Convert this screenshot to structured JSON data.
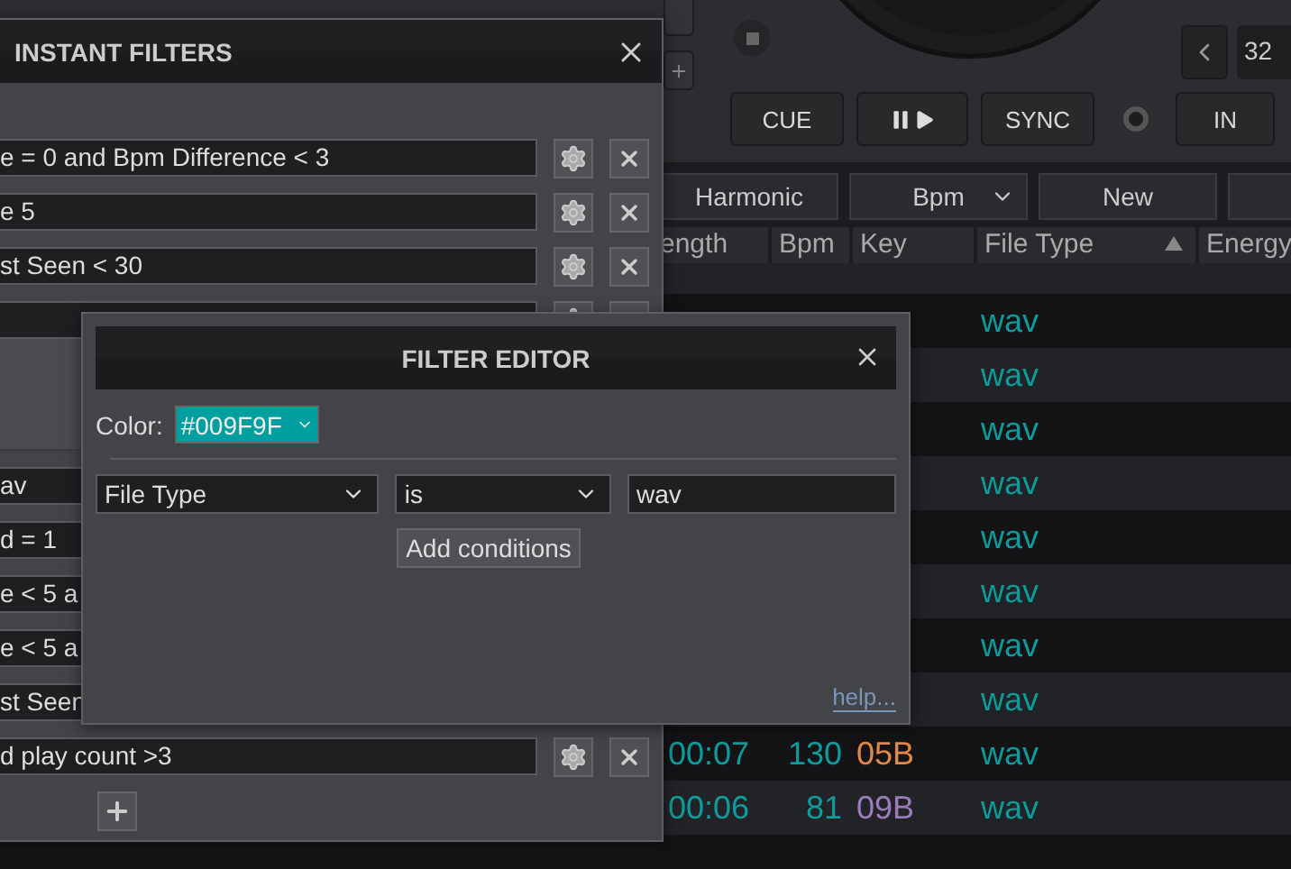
{
  "deck": {
    "buttons": [
      {
        "kind": "text",
        "label": "CUE"
      },
      {
        "kind": "playpause"
      },
      {
        "kind": "text",
        "label": "SYNC"
      }
    ],
    "in_button": "IN",
    "loop_value": "32"
  },
  "toolbar": [
    {
      "label": "Harmonic",
      "dropdown": false
    },
    {
      "label": "Bpm",
      "dropdown": true
    },
    {
      "label": "New",
      "dropdown": false
    }
  ],
  "table": {
    "columns": [
      {
        "label": "ength",
        "sorted": false
      },
      {
        "label": "Bpm",
        "sorted": false
      },
      {
        "label": "Key",
        "sorted": false
      },
      {
        "label": "File Type",
        "sorted": true
      },
      {
        "label": "Energy",
        "sorted": false
      }
    ],
    "rows": [
      {
        "file_type": "wav"
      },
      {
        "file_type": "wav"
      },
      {
        "file_type": "wav"
      },
      {
        "file_type": "wav"
      },
      {
        "file_type": "wav"
      },
      {
        "file_type": "wav"
      },
      {
        "file_type": "wav"
      },
      {
        "file_type": "wav"
      },
      {
        "length": "00:07",
        "bpm": "130",
        "key": "05B",
        "color": "#e0884a",
        "file_type": "wav"
      },
      {
        "length": "00:06",
        "bpm": "81",
        "key": "09B",
        "color": "#9a7cbc",
        "file_type": "wav"
      }
    ]
  },
  "instant_filters": {
    "title": "INSTANT FILTERS",
    "filters": [
      {
        "text": "e = 0 and Bpm Difference < 3"
      },
      {
        "text": "e 5"
      },
      {
        "text": "st Seen < 30"
      }
    ],
    "more_filters": [
      {
        "text": "av"
      },
      {
        "text": "d = 1"
      },
      {
        "text": "e < 5 a"
      },
      {
        "text": "e < 5 a"
      },
      {
        "text": "st Seen"
      },
      {
        "text": "d play count >3"
      }
    ]
  },
  "filter_editor": {
    "title": "FILTER EDITOR",
    "color_label": "Color:",
    "color": "#009f9f",
    "color_value": "#009F9F",
    "field": "File Type",
    "operator": "is",
    "value": "wav",
    "add_button": "Add conditions",
    "help": "help..."
  }
}
